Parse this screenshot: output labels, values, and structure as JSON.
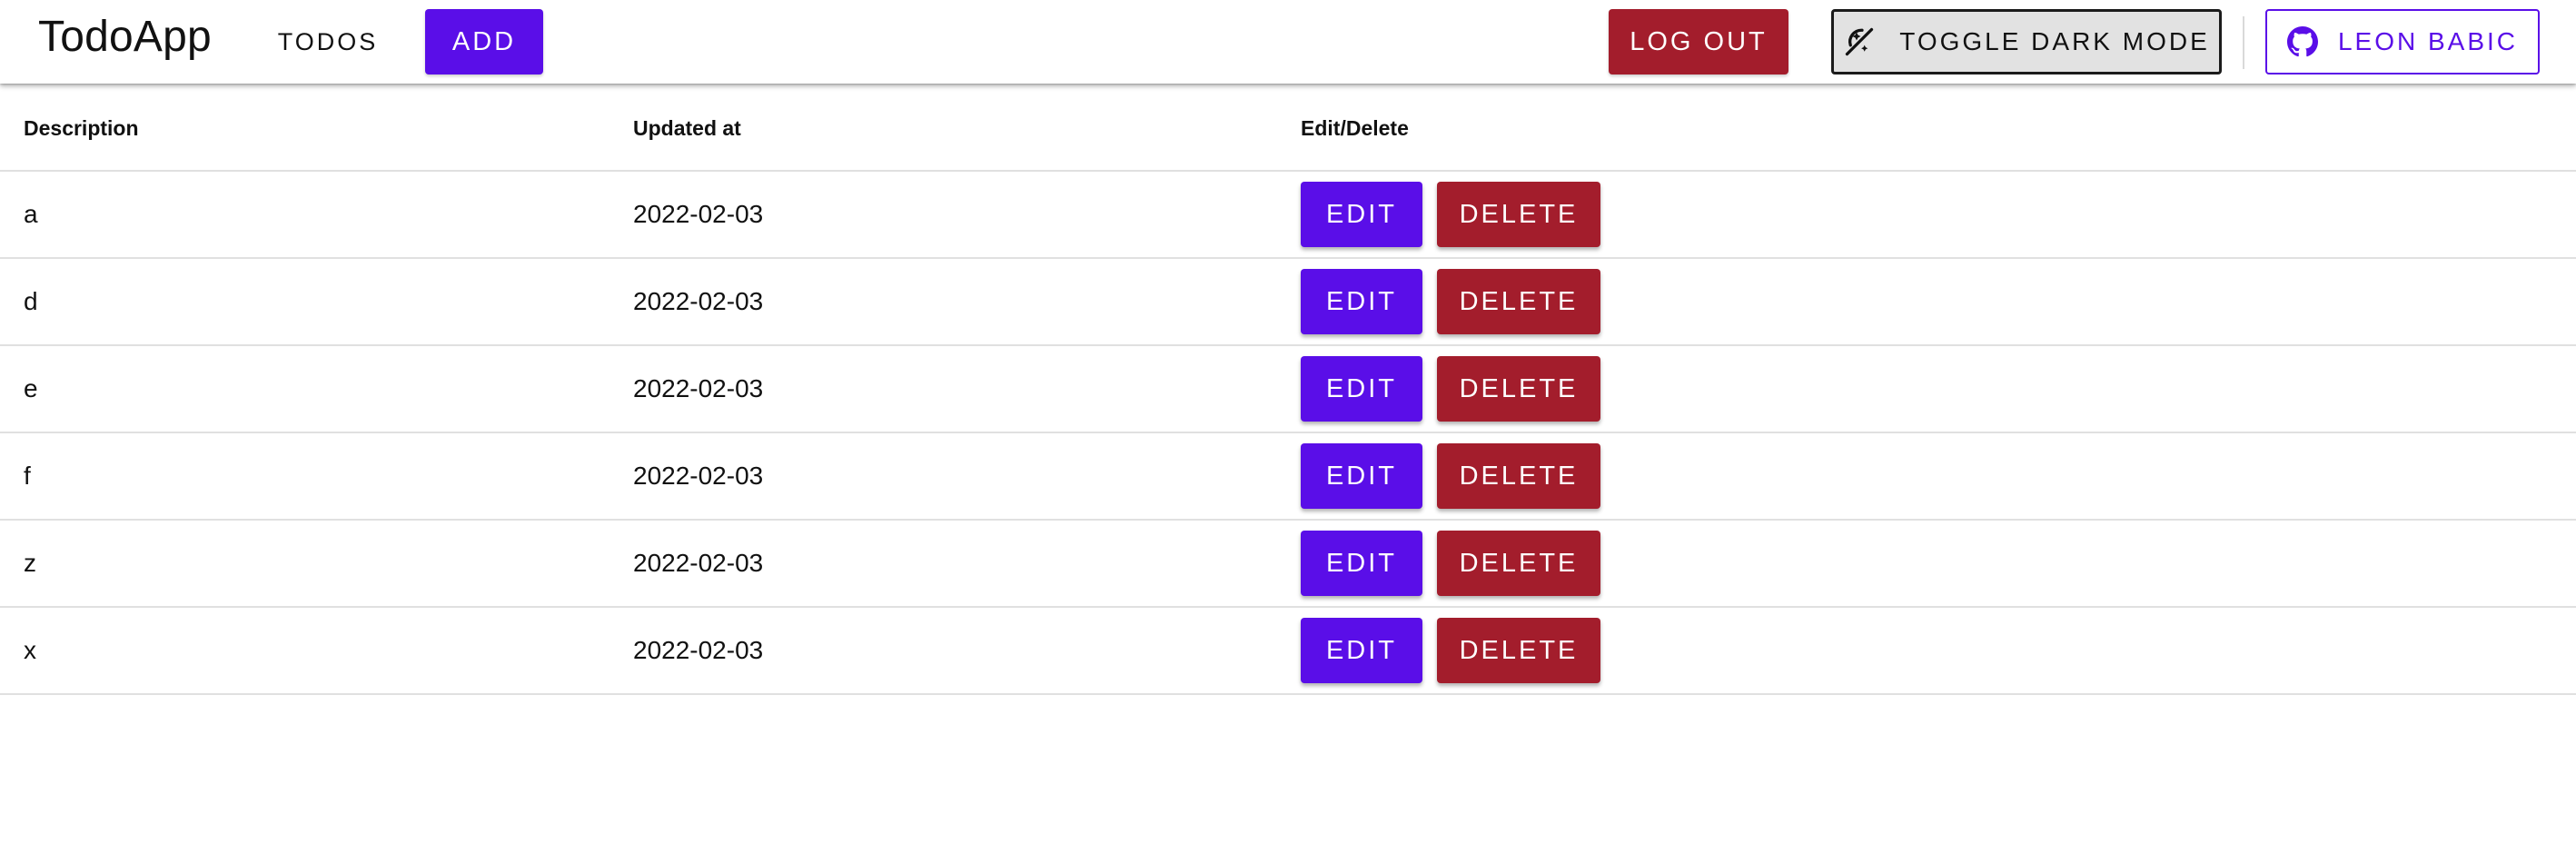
{
  "header": {
    "brand": "TodoApp",
    "nav_todos": "Todos",
    "nav_add": "Add",
    "logout": "Log out",
    "dark_mode": "Toggle dark mode",
    "github": "Leon Babic",
    "dark_mode_icon": "brightness-auto-icon",
    "github_icon": "github-icon"
  },
  "table": {
    "headers": [
      "Description",
      "Updated at",
      "Edit/Delete"
    ],
    "edit_label": "Edit",
    "delete_label": "Delete",
    "rows": [
      {
        "description": "a",
        "updated": "2022-02-03"
      },
      {
        "description": "d",
        "updated": "2022-02-03"
      },
      {
        "description": "e",
        "updated": "2022-02-03"
      },
      {
        "description": "f",
        "updated": "2022-02-03"
      },
      {
        "description": "z",
        "updated": "2022-02-03"
      },
      {
        "description": "x",
        "updated": "2022-02-03"
      }
    ]
  },
  "colors": {
    "primary": "#5a0ee8",
    "danger": "#a31d2c"
  }
}
